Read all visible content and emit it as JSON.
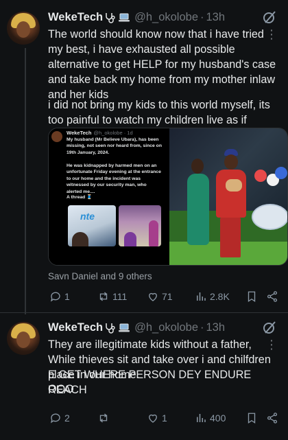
{
  "tweets": [
    {
      "author": "WekeTech",
      "handle": "@h_okolobe",
      "time": "13h",
      "text_p1": "The world should know now that i have tried my best, i have exhausted all possible alternative to get HELP for my husband's case and take back my home from my mother inlaw and her kids",
      "text_p2": "i did not bring my kids to this world myself, its too painful to watch my children live as if",
      "embedded_screenshot": {
        "author": "WekeTech",
        "handle": "@h_okolobe · 1d",
        "text1": "My husband (Mr Believe Ubara), has been missing, not seen nor heard from, since on 19th January, 2024.",
        "text2": "He was kidnapped by harmed men on an unfortunate Friday evening at the entrance to our home and the incident was witnessed by our security man, who alerted me....",
        "text3": "A thread 🧵",
        "logo_text": "nte"
      },
      "liked_by": "Savn Daniel and 9 others",
      "stats": {
        "replies": "1",
        "reposts": "111",
        "likes": "71",
        "views": "2.8K"
      }
    },
    {
      "author": "WekeTech",
      "handle": "@h_okolobe",
      "time": "13h",
      "text_p1": "They are illegitimate kids without a father, While thieves sit and take over i and chilfdren place in our home.",
      "text_p2": "E GET WHERE PERSON DEY ENDURE REACH",
      "text_p3": "OOO",
      "stats": {
        "replies": "2",
        "reposts": "",
        "likes": "1",
        "views": "400"
      }
    }
  ],
  "colors": {
    "background": "#101214",
    "text": "#e7e9ea",
    "muted": "#71767b",
    "divider": "#2f3336"
  },
  "icons": [
    "stethoscope-icon",
    "laptop-icon",
    "grok-icon",
    "more-icon",
    "reply-icon",
    "repost-icon",
    "like-icon",
    "views-icon",
    "bookmark-icon",
    "share-icon"
  ]
}
